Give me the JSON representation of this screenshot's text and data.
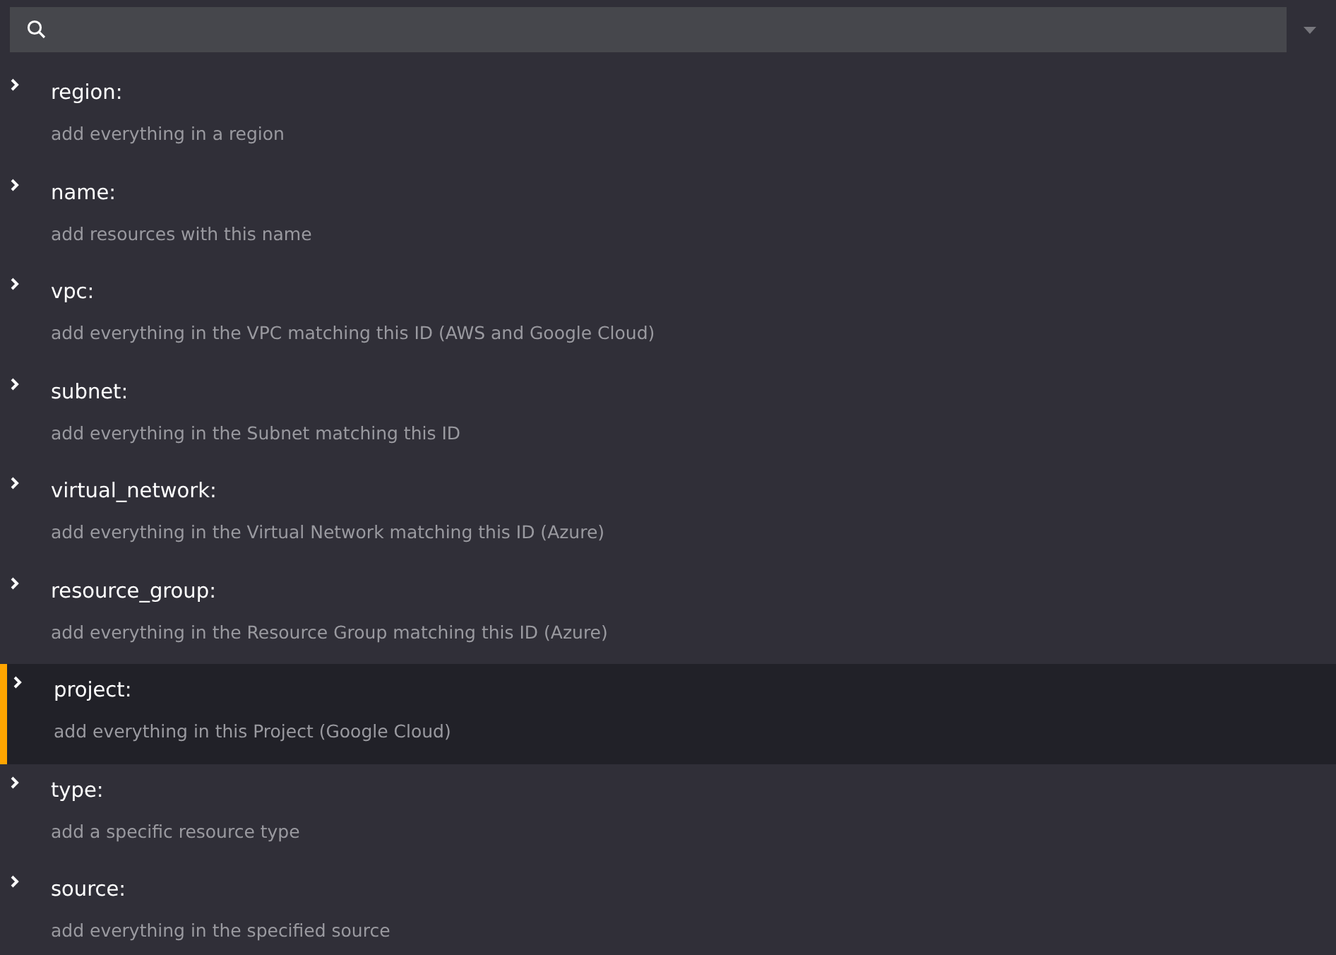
{
  "items": [
    {
      "title": "region:",
      "description": "add everything in a region",
      "selected": false
    },
    {
      "title": "name:",
      "description": "add resources with this name",
      "selected": false
    },
    {
      "title": "vpc:",
      "description": "add everything in the VPC matching this ID (AWS and Google Cloud)",
      "selected": false
    },
    {
      "title": "subnet:",
      "description": "add everything in the Subnet matching this ID",
      "selected": false
    },
    {
      "title": "virtual_network:",
      "description": "add everything in the Virtual Network matching this ID (Azure)",
      "selected": false
    },
    {
      "title": "resource_group:",
      "description": "add everything in the Resource Group matching this ID (Azure)",
      "selected": false
    },
    {
      "title": "project:",
      "description": "add everything in this Project (Google Cloud)",
      "selected": true
    },
    {
      "title": "type:",
      "description": "add a specific resource type",
      "selected": false
    },
    {
      "title": "source:",
      "description": "add everything in the specified source",
      "selected": false
    }
  ]
}
